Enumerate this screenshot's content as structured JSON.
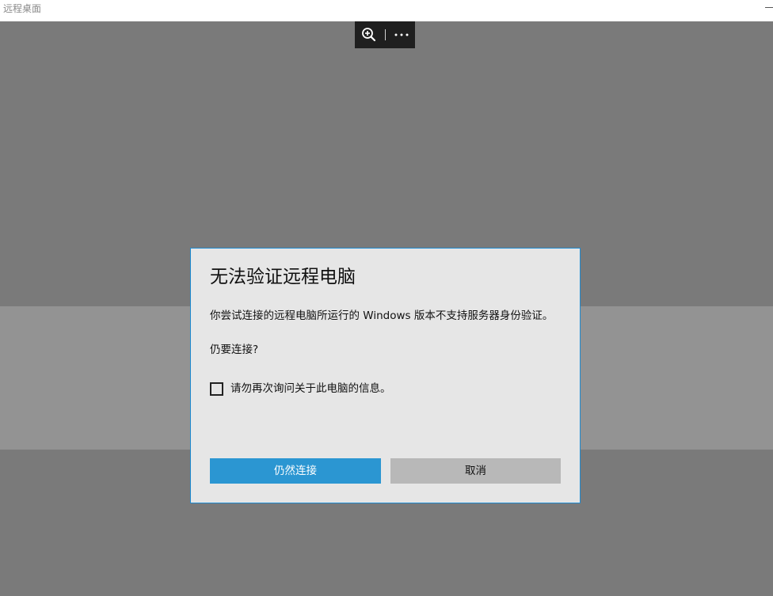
{
  "window": {
    "title": "远程桌面"
  },
  "toolbar": {
    "zoom_icon": "zoom-in-icon",
    "more_icon": "more-options-icon"
  },
  "dialog": {
    "title": "无法验证远程电脑",
    "message": "你尝试连接的远程电脑所运行的 Windows 版本不支持服务器身份验证。",
    "question": "仍要连接?",
    "checkbox_label": "请勿再次询问关于此电脑的信息。",
    "checkbox_checked": false,
    "connect_button": "仍然连接",
    "cancel_button": "取消"
  },
  "colors": {
    "accent": "#2b96d2",
    "dialog_border": "#1e8bd1",
    "backdrop": "#7a7a7a"
  }
}
